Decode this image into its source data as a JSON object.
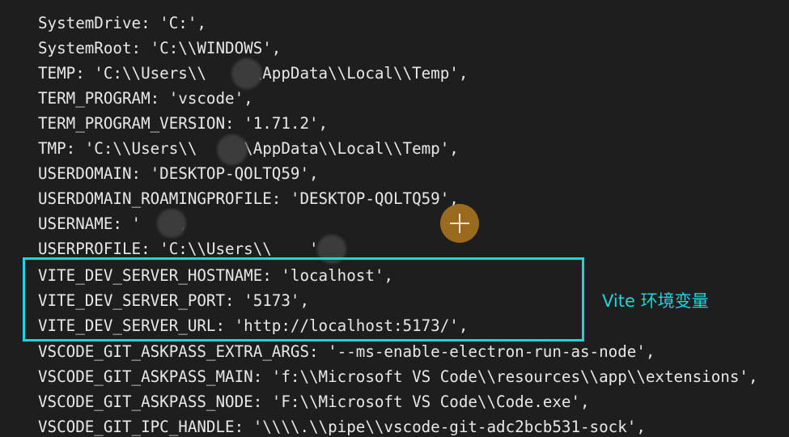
{
  "terminal": {
    "lines": [
      "SystemDrive: 'C:',",
      "SystemRoot: 'C:\\\\WINDOWS',",
      "TEMP: 'C:\\\\Users\\\\    \\\\AppData\\\\Local\\\\Temp',",
      "TERM_PROGRAM: 'vscode',",
      "TERM_PROGRAM_VERSION: '1.71.2',",
      "TMP: 'C:\\\\Users\\\\    \\\\AppData\\\\Local\\\\Temp',",
      "USERDOMAIN: 'DESKTOP-QOLTQ59',",
      "USERDOMAIN_ROAMINGPROFILE: 'DESKTOP-QOLTQ59',",
      "USERNAME: '   ',",
      "USERPROFILE: 'C:\\\\Users\\\\    ',",
      "VITE_DEV_SERVER_HOSTNAME: 'localhost',",
      "VITE_DEV_SERVER_PORT: '5173',",
      "VITE_DEV_SERVER_URL: 'http://localhost:5173/',",
      "VSCODE_GIT_ASKPASS_EXTRA_ARGS: '--ms-enable-electron-run-as-node',",
      "VSCODE_GIT_ASKPASS_MAIN: 'f:\\\\Microsoft VS Code\\\\resources\\\\app\\\\extensions',",
      "VSCODE_GIT_ASKPASS_NODE: 'F:\\\\Microsoft VS Code\\\\Code.exe',",
      "VSCODE_GIT_IPC_HANDLE: '\\\\\\\\.\\\\pipe\\\\vscode-git-adc2bcb531-sock',"
    ]
  },
  "annotation": {
    "text": "Vite 环境变量",
    "color": "#1fd4db"
  },
  "colors": {
    "background": "#1e1e1e",
    "text": "#e8e8e8",
    "highlight": "#1fd4db",
    "cursor": "#b0781e"
  }
}
